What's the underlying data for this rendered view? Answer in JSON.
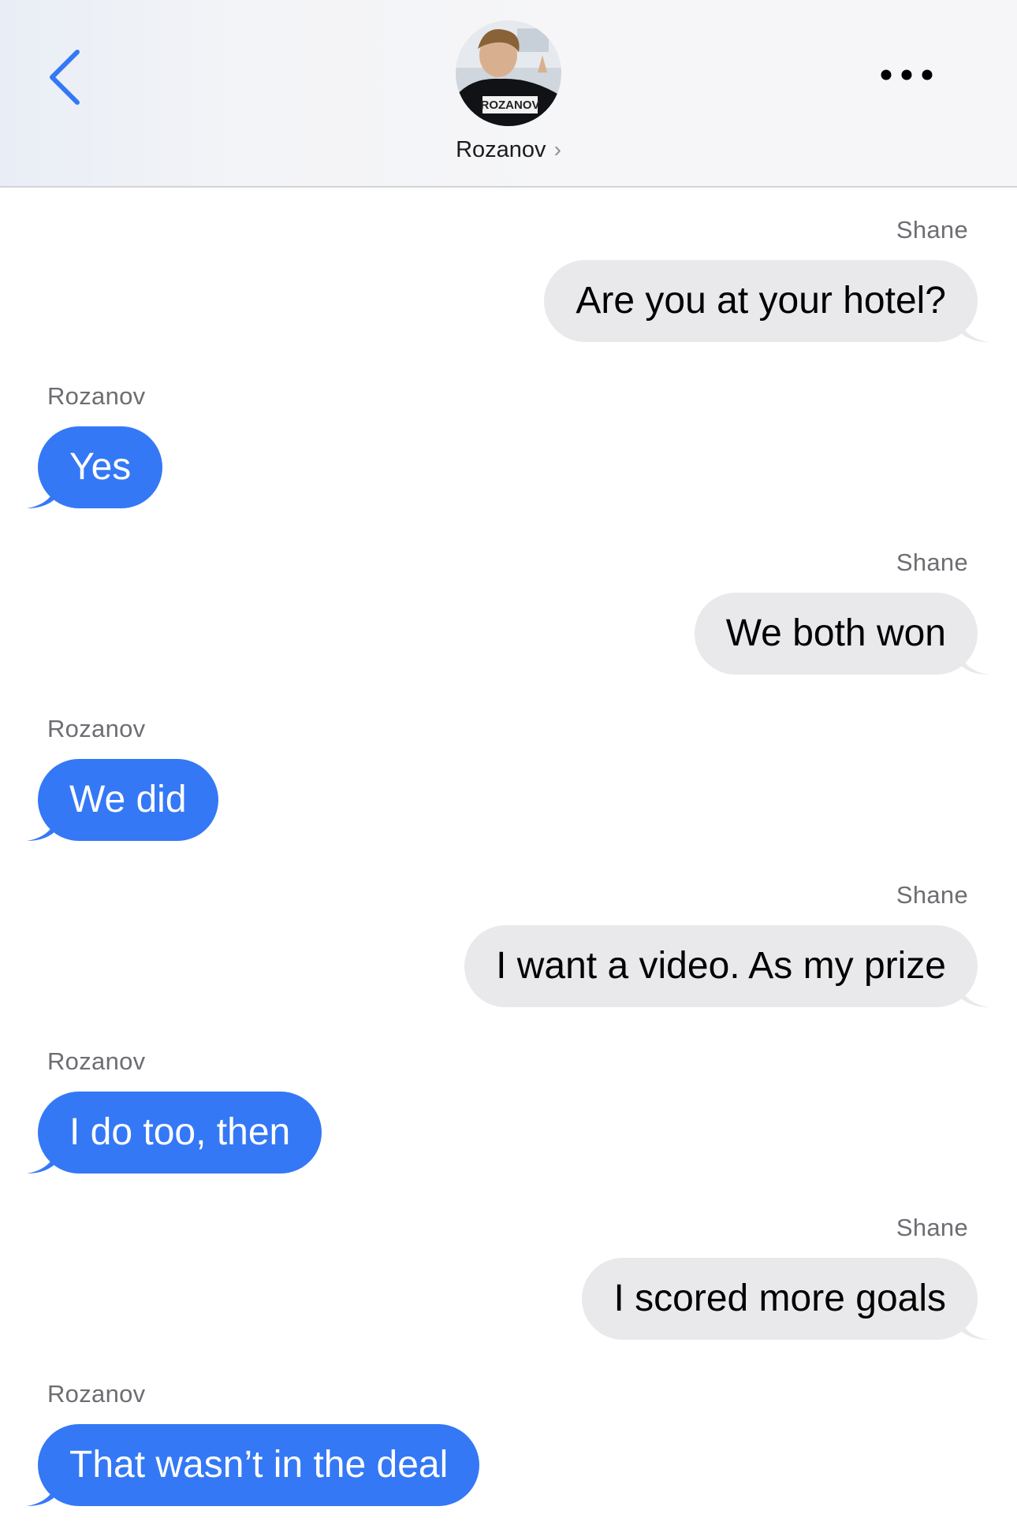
{
  "header": {
    "contact_name": "Rozanov",
    "avatar_text": "ROZANOV",
    "chevron": "›",
    "back_icon": "chevron-left-icon",
    "more_icon": "ellipsis-icon",
    "accent_color": "#3478f6"
  },
  "messages": [
    {
      "sender": "Shane",
      "text": "Are you at your hotel?",
      "direction": "outgoing"
    },
    {
      "sender": "Rozanov",
      "text": "Yes",
      "direction": "incoming"
    },
    {
      "sender": "Shane",
      "text": "We both won",
      "direction": "outgoing"
    },
    {
      "sender": "Rozanov",
      "text": "We did",
      "direction": "incoming"
    },
    {
      "sender": "Shane",
      "text": "I want a video. As my prize",
      "direction": "outgoing"
    },
    {
      "sender": "Rozanov",
      "text": "I do too, then",
      "direction": "incoming"
    },
    {
      "sender": "Shane",
      "text": "I scored more goals",
      "direction": "outgoing"
    },
    {
      "sender": "Rozanov",
      "text": "That wasn’t in the deal",
      "direction": "incoming"
    }
  ],
  "colors": {
    "incoming_bubble": "#3478f6",
    "outgoing_bubble": "#e9e9eb"
  }
}
